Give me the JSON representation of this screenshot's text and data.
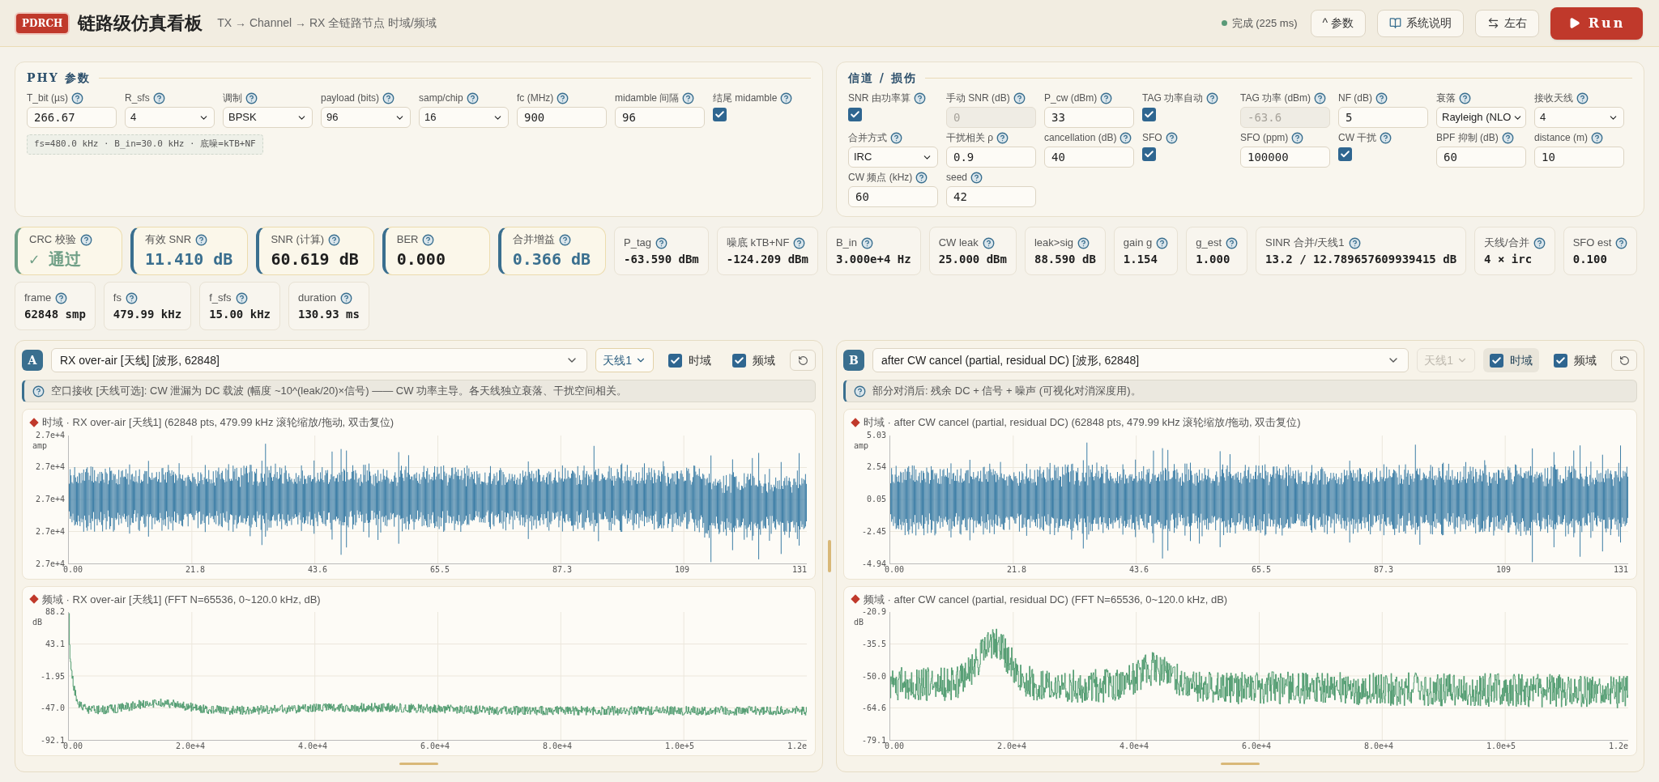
{
  "header": {
    "logo": "PDRCH",
    "title": "链路级仿真看板",
    "subtitle": "TX → Channel → RX 全链路节点 时域/频域",
    "status": {
      "text": "完成 (225 ms)",
      "color": "#5a9a78"
    },
    "buttons": [
      {
        "kind": "toggle",
        "label": "^ 参数"
      },
      {
        "kind": "docs",
        "label": "系统说明"
      },
      {
        "kind": "swap",
        "label": "左右"
      },
      {
        "kind": "run",
        "label": "Run"
      }
    ]
  },
  "phy": {
    "title": "PHY 参数",
    "info": "fs=480.0 kHz · B_in=30.0 kHz · 底噪=kTB+NF",
    "fields": [
      {
        "label": "T_bit (µs)",
        "kind": "input",
        "value": "266.67",
        "disabled": false
      },
      {
        "label": "R_sfs",
        "kind": "select",
        "value": "4",
        "disabled": false
      },
      {
        "label": "调制",
        "kind": "select",
        "value": "BPSK",
        "disabled": false
      },
      {
        "label": "payload (bits)",
        "kind": "select",
        "value": "96",
        "disabled": false
      },
      {
        "label": "samp/chip",
        "kind": "select",
        "value": "16",
        "disabled": false
      },
      {
        "label": "fc (MHz)",
        "kind": "input",
        "value": "900",
        "disabled": false
      },
      {
        "label": "midamble 间隔",
        "kind": "input",
        "value": "96",
        "disabled": false
      },
      {
        "label": "结尾 midamble",
        "kind": "checkbox",
        "checked": true,
        "disabled": false
      }
    ]
  },
  "channel": {
    "title": "信道 / 损伤",
    "fields": [
      {
        "label": "SNR 由功率算",
        "kind": "checkbox",
        "checked": true,
        "disabled": false
      },
      {
        "label": "手动 SNR (dB)",
        "kind": "input",
        "value": "0",
        "disabled": true
      },
      {
        "label": "P_cw (dBm)",
        "kind": "input",
        "value": "33",
        "disabled": false
      },
      {
        "label": "TAG 功率自动",
        "kind": "checkbox",
        "checked": true,
        "disabled": false
      },
      {
        "label": "TAG 功率 (dBm)",
        "kind": "input",
        "value": "-63.6",
        "disabled": true
      },
      {
        "label": "NF (dB)",
        "kind": "input",
        "value": "5",
        "disabled": false
      },
      {
        "label": "衰落",
        "kind": "select",
        "value": "Rayleigh (NLO",
        "disabled": false
      },
      {
        "label": "接收天线",
        "kind": "select",
        "value": "4",
        "disabled": false
      },
      {
        "label": "合并方式",
        "kind": "select",
        "value": "IRC",
        "disabled": false
      },
      {
        "label": "干扰相关 ρ",
        "kind": "input",
        "value": "0.9",
        "disabled": false
      },
      {
        "label": "cancellation (dB)",
        "kind": "input",
        "value": "40",
        "disabled": false
      },
      {
        "label": "SFO",
        "kind": "checkbox",
        "checked": true,
        "disabled": false
      },
      {
        "label": "SFO (ppm)",
        "kind": "input",
        "value": "100000",
        "disabled": false
      },
      {
        "label": "CW 干扰",
        "kind": "checkbox",
        "checked": true,
        "disabled": false
      },
      {
        "label": "BPF 抑制 (dB)",
        "kind": "input",
        "value": "60",
        "disabled": false
      },
      {
        "label": "distance (m)",
        "kind": "input",
        "value": "10",
        "disabled": false
      },
      {
        "label": "CW 频点 (kHz)",
        "kind": "input",
        "value": "60",
        "disabled": false
      },
      {
        "label": "seed",
        "kind": "input",
        "value": "42",
        "disabled": false
      }
    ]
  },
  "metric_rows": [
    {
      "cards": [
        {
          "kind": "primary",
          "label": "CRC 校验",
          "value": "✓ 通过",
          "color": "#6f9f86",
          "highlight": true
        },
        {
          "kind": "primary",
          "label": "有效 SNR",
          "value": "11.410 dB",
          "color": "#3a6f8f",
          "highlight": true
        },
        {
          "kind": "primary",
          "label": "SNR (计算)",
          "value": "60.619 dB",
          "color": "#3a6f8f",
          "highlight": false
        },
        {
          "kind": "primary",
          "label": "BER",
          "value": "0.000",
          "color": "#3a6f8f",
          "highlight": false
        },
        {
          "kind": "primary",
          "label": "合并增益",
          "value": "0.366 dB",
          "color": "#3a6f8f",
          "highlight": true
        },
        {
          "kind": "plain",
          "label": "P_tag",
          "value": "-63.590 dBm"
        },
        {
          "kind": "plain",
          "label": "噪底 kTB+NF",
          "value": "-124.209 dBm"
        },
        {
          "kind": "plain",
          "label": "B_in",
          "value": "3.000e+4 Hz"
        },
        {
          "kind": "plain",
          "label": "CW leak",
          "value": "25.000 dBm"
        },
        {
          "kind": "plain",
          "label": "leak>sig",
          "value": "88.590 dB"
        },
        {
          "kind": "plain",
          "label": "gain g",
          "value": "1.154"
        },
        {
          "kind": "plain",
          "label": "g_est",
          "value": "1.000"
        },
        {
          "kind": "plain",
          "label": "SINR 合并/天线1",
          "value": "13.2 / 12.789657609939415 dB"
        },
        {
          "kind": "plain",
          "label": "天线/合并",
          "value": "4 × irc"
        },
        {
          "kind": "plain",
          "label": "SFO est",
          "value": "0.100"
        }
      ]
    },
    {
      "cards": [
        {
          "kind": "plain",
          "label": "frame",
          "value": "62848 smp"
        },
        {
          "kind": "plain",
          "label": "fs",
          "value": "479.99 kHz"
        },
        {
          "kind": "plain",
          "label": "f_sfs",
          "value": "15.00 kHz"
        },
        {
          "kind": "plain",
          "label": "duration",
          "value": "130.93 ms"
        }
      ]
    }
  ],
  "panels": [
    {
      "letter": "A",
      "source": "RX over-air [天线] [波形, 62848]",
      "antenna": {
        "value": "天线1",
        "disabled": false
      },
      "toggles": [
        {
          "label": "时域",
          "checked": true,
          "highlighted": false
        },
        {
          "label": "频域",
          "checked": true,
          "highlighted": false
        }
      ],
      "note": "空口接收 [天线可选]: CW 泄漏为 DC 载波 (幅度 ~10^(leak/20)×信号) —— CW 功率主导。各天线独立衰落、干扰空间相关。",
      "plots": [
        {
          "kind": "time",
          "title": "时域 · RX over-air [天线1] (62848 pts, 479.99 kHz 滚轮缩放/拖动, 双击复位)",
          "unit": "amp",
          "y_labels": [
            "2.7e+4",
            "2.7e+4",
            "2.7e+4",
            "2.7e+4",
            "2.7e+4"
          ],
          "x_labels": [
            "0.00",
            "21.8",
            "43.6",
            "65.5",
            "87.3",
            "109",
            "131"
          ]
        },
        {
          "kind": "freq",
          "title": "频域 · RX over-air [天线1] (FFT N=65536, 0~120.0 kHz, dB)",
          "unit": "dB",
          "y_labels": [
            "88.2",
            "43.1",
            "-1.95",
            "-47.0",
            "-92.1"
          ],
          "x_labels": [
            "0.00",
            "2.0e+4",
            "4.0e+4",
            "6.0e+4",
            "8.0e+4",
            "1.0e+5",
            "1.2e"
          ]
        }
      ]
    },
    {
      "letter": "B",
      "source": "after CW cancel (partial, residual DC) [波形, 62848]",
      "antenna": {
        "value": "天线1",
        "disabled": true
      },
      "toggles": [
        {
          "label": "时域",
          "checked": true,
          "highlighted": true
        },
        {
          "label": "频域",
          "checked": true,
          "highlighted": false
        }
      ],
      "note": "部分对消后: 残余 DC + 信号 + 噪声 (可视化对消深度用)。",
      "plots": [
        {
          "kind": "time",
          "title": "时域 · after CW cancel (partial, residual DC) (62848 pts, 479.99 kHz 滚轮缩放/拖动, 双击复位)",
          "unit": "amp",
          "y_labels": [
            "5.03",
            "2.54",
            "0.05",
            "-2.45",
            "-4.94"
          ],
          "x_labels": [
            "0.00",
            "21.8",
            "43.6",
            "65.5",
            "87.3",
            "109",
            "131"
          ]
        },
        {
          "kind": "freq",
          "title": "频域 · after CW cancel (partial, residual DC) (FFT N=65536, 0~120.0 kHz, dB)",
          "unit": "dB",
          "y_labels": [
            "-20.9",
            "-35.5",
            "-50.0",
            "-64.6",
            "-79.1"
          ],
          "x_labels": [
            "0.00",
            "2.0e+4",
            "4.0e+4",
            "6.0e+4",
            "8.0e+4",
            "1.0e+5",
            "1.2e"
          ]
        }
      ]
    }
  ]
}
